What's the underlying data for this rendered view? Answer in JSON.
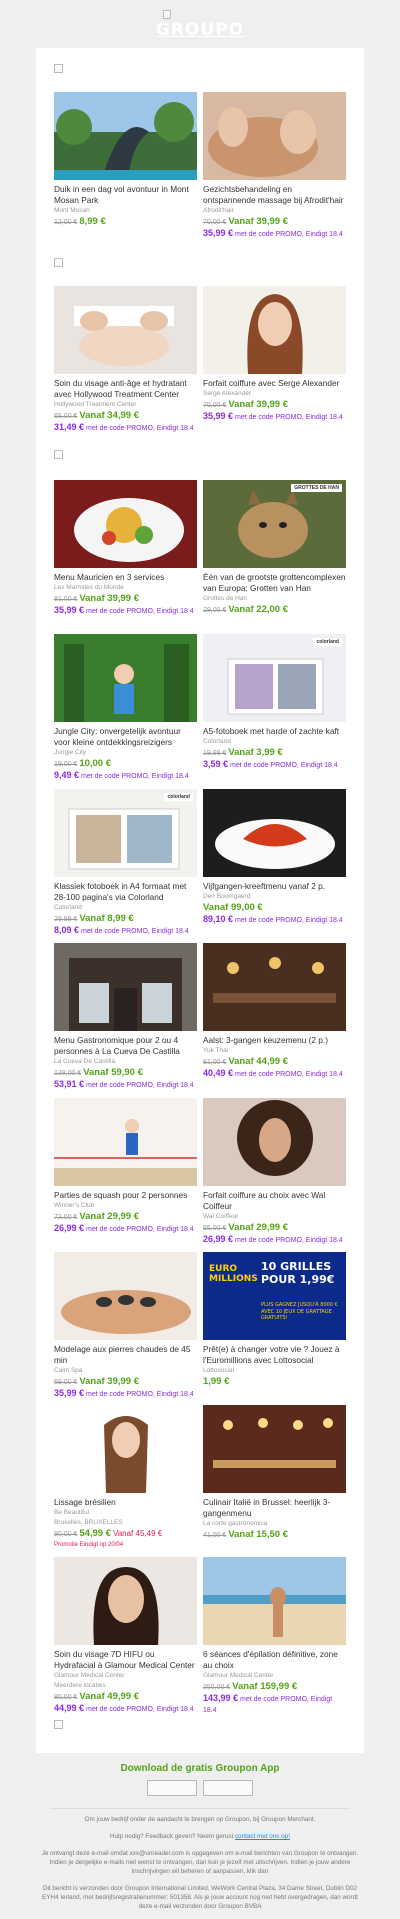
{
  "header": {
    "logo": "GROUPO"
  },
  "deals": [
    {
      "title": "Duik in een dag vol avontuur in Mont Mosan Park",
      "merchant": "Mont Mosan",
      "old": "12,00 €",
      "new": "8,99 €",
      "promo_price": "",
      "promo_text": "",
      "image": "seal-statue-photo"
    },
    {
      "title": "Gezichtsbehandeling en ontspannende massage bij Afrodit'hair",
      "merchant": "Afrodit'hair",
      "old": "70,00 €",
      "new": "Vanaf 39,99 €",
      "promo_price": "35,99 €",
      "promo_text": "met de code PROMO, Eindigt 18.4",
      "image": "massage-photo"
    },
    {
      "title": "Soin du visage anti-âge et hydratant avec Hollywood Treatment Center",
      "merchant": "Hollywood Treatment Center",
      "old": "65,00 €",
      "new": "Vanaf 34,99 €",
      "promo_price": "31,49 €",
      "promo_text": "met de code PROMO, Eindigt 18.4",
      "image": "facial-photo"
    },
    {
      "title": "Forfait coiffure avec Serge Alexander",
      "merchant": "Serge Alexander",
      "old": "70,00 €",
      "new": "Vanaf 39,99 €",
      "promo_price": "35,99 €",
      "promo_text": "met de code PROMO, Eindigt 18.4",
      "image": "hair-photo"
    },
    {
      "title": "Menu Mauricien en 3 services",
      "merchant": "Les Marmites du Monde",
      "old": "81,00 €",
      "new": "Vanaf 39,99 €",
      "promo_price": "35,99 €",
      "promo_text": "met de code PROMO, Eindigt 18.4",
      "image": "food-photo"
    },
    {
      "title": "Één van de grootste grottencomplexen van Europa: Grotten van Han",
      "merchant": "Grottes de Han",
      "old": "29,00 €",
      "new": "Vanaf 22,00 €",
      "promo_price": "",
      "promo_text": "",
      "image": "lynx-photo",
      "badge": "GROTTES DE HAN"
    },
    {
      "title": "Jungle City: onvergetelijk avontuur voor kleine ontdekkingsreizigers",
      "merchant": "Jungle City",
      "old": "19,00 €",
      "new": "10,00 €",
      "promo_price": "9,49 €",
      "promo_text": "met de code PROMO, Eindigt 18.4",
      "image": "playground-photo"
    },
    {
      "title": "A5-fotoboek met harde of zachte kaft",
      "merchant": "Colorland",
      "old": "19,99 €",
      "new": "Vanaf 3,99 €",
      "promo_price": "3,59 €",
      "promo_text": "met de code PROMO, Eindigt 18.4",
      "image": "photobook-photo",
      "badge": "colorland"
    },
    {
      "title": "Klassiek fotoboek in A4 formaat met 28-100 pagina's via Colorland",
      "merchant": "Colorland",
      "old": "29,99 €",
      "new": "Vanaf 8,99 €",
      "promo_price": "8,09 €",
      "promo_text": "met de code PROMO, Eindigt 18.4",
      "image": "photobook-a4-photo",
      "badge": "colorland"
    },
    {
      "title": "Vijfgangen-kreeftmenu vanaf 2 p.",
      "merchant": "Den Boomgaerd",
      "old": "",
      "new": "Vanaf 99,00 €",
      "promo_price": "89,10 €",
      "promo_text": "met de code PROMO, Eindigt 18.4",
      "image": "lobster-photo"
    },
    {
      "title": "Menu Gastronomique pour 2 ou 4 personnes à La Cueva De Castilla",
      "merchant": "La Cueva De Castilla",
      "old": "138,00 €",
      "new": "Vanaf 59,90 €",
      "promo_price": "53,91 €",
      "promo_text": "met de code PROMO, Eindigt 18.4",
      "image": "storefront-photo"
    },
    {
      "title": "Aalst: 3-gangen keuzemenu (2 p.)",
      "merchant": "Yuk Thai",
      "old": "81,00 €",
      "new": "Vanaf 44,99 €",
      "promo_price": "40,49 €",
      "promo_text": "met de code PROMO, Eindigt 18.4",
      "image": "restaurant-photo"
    },
    {
      "title": "Parties de squash pour 2 personnes",
      "merchant": "Winner's Club",
      "old": "72,00 €",
      "new": "Vanaf 29,99 €",
      "promo_price": "26,99 €",
      "promo_text": "met de code PROMO, Eindigt 18.4",
      "image": "squash-photo"
    },
    {
      "title": "Forfait coiffure au choix avec Wal Coiffeur",
      "merchant": "Wal Coiffeur",
      "old": "55,00 €",
      "new": "Vanaf 29,99 €",
      "promo_price": "26,99 €",
      "promo_text": "met de code PROMO, Eindigt 18.4",
      "image": "curly-hair-photo"
    },
    {
      "title": "Modelage aux pierres chaudes de 45 min",
      "merchant": "Calm Spa",
      "old": "69,00 €",
      "new": "Vanaf 39,99 €",
      "promo_price": "35,99 €",
      "promo_text": "met de code PROMO, Eindigt 18.4",
      "image": "hot-stones-photo"
    },
    {
      "title": "Prêt(e) à changer votre vie ? Jouez à l'Euromillions avec Lottosocial",
      "merchant": "Lottosocial",
      "old": "",
      "new": "1,99 €",
      "promo_price": "",
      "promo_text": "",
      "image": "euromillions-banner",
      "banner": {
        "brand": "EURO MILLIONS",
        "headline": "10 GRILLES POUR 1,99€",
        "sub": "PLUS GAGNEZ JUSQU'À 8000 € AVEC 10 JEUX DE GRATTAGE GRATUITS!"
      }
    },
    {
      "title": "Lissage brésilien",
      "merchant": "Be Beautiful",
      "merchant2": "Bruxelles, BRUXELLES",
      "old": "90,00 €",
      "new": "54,99 €",
      "new_extra": "Vanaf 45,49 €",
      "promo_price": "",
      "promo_text": "Promotie Eindigt op 20/04",
      "image": "straight-hair-photo"
    },
    {
      "title": "Culinair Italië in Brussel: heerlijk 3-gangenmenu",
      "merchant": "La corte gastronomica",
      "old": "41,00 €",
      "new": "Vanaf 15,50 €",
      "promo_price": "",
      "promo_text": "",
      "image": "italian-restaurant-photo"
    },
    {
      "title": "Soin du visage 7D HIFU ou Hydrafacial à Glamour Medical Center",
      "merchant": "Glamour Medical Center",
      "merchant2": "Meerdere locaties",
      "old": "80,00 €",
      "new": "Vanaf 49,99 €",
      "promo_price": "44,99 €",
      "promo_text": "met de code PROMO, Eindigt 18.4",
      "image": "portrait-photo"
    },
    {
      "title": "6 séances d'épilation définitive, zone au choix",
      "merchant": "Glamour Medical Center",
      "old": "250,00 €",
      "new": "Vanaf 159,99 €",
      "promo_price": "143,99 €",
      "promo_text": "met de code PROMO, Eindigt 18.4",
      "image": "beach-photo"
    }
  ],
  "footer": {
    "app_title": "Download de gratis Groupon App",
    "line1": "Om jouw bedrijf onder de aandacht te brengen op Groupon, bij Groupon Merchant.",
    "help_prefix": "Hulp nodig? Feedback geven? Neem gerust",
    "help_link": "contact met ons op!",
    "line3": "Je ontvangt deze e-mail omdat xxx@unreader.com is opgegeven om e-mail berichten van Groupon te ontvangen. Indien je dergelijke e-mails niet wenst te ontvangen, dan kun je jezelf met uitschrijven. Indien je jouw andere inschrijvingen wil beheren of aanpassen, klik dan",
    "line4": "Dit bericht is verzonden door Groupon International Limited, WeWork Central Plaza, 34 Dame Street, Dublin D02 EYH4 Ierland, met bedrijfsregistratienummer: 501358. Als je jouw account nog niet hebt overgedragen, dan wordt deze e-mail verzonden door Groupon BVBA"
  },
  "colors": {
    "green": "#53a318",
    "purple": "#8b2be2",
    "background": "#efefef"
  }
}
